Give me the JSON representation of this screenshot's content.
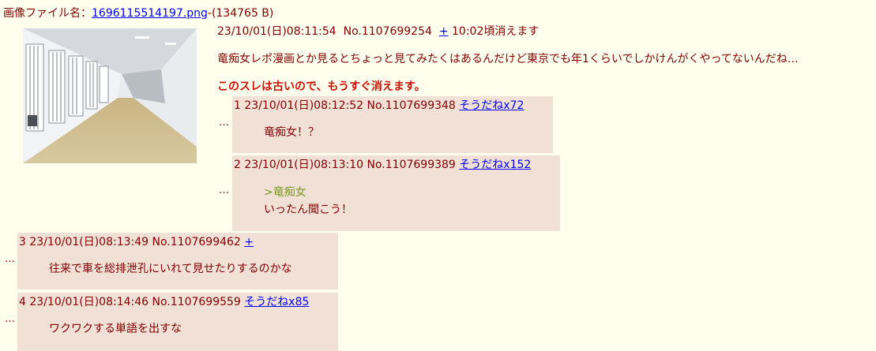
{
  "file": {
    "label": "画像ファイル名：",
    "name": "1696115514197.png",
    "size": "-(134765 B)"
  },
  "thumbnail": {
    "icon": "corridor-photo"
  },
  "op": {
    "date": "23/10/01(日)08:11:54",
    "no": "No.1107699254",
    "plus": "+",
    "expiry": "10:02頃消えます",
    "body": "竜痴女レポ漫画とか見るとちょっと見てみたくはあるんだけど東京でも年1くらいでしかけんがくやってないんだね…",
    "warning": "このスレは古いので、もうすぐ消えます。"
  },
  "replies": [
    {
      "num": "1",
      "date": "23/10/01(日)08:12:52",
      "no": "No.1107699348",
      "sodane": "そうだねx72",
      "lines": [
        "竜痴女！？"
      ]
    },
    {
      "num": "2",
      "date": "23/10/01(日)08:13:10",
      "no": "No.1107699389",
      "sodane": "そうだねx152",
      "quote": ">竜痴女",
      "lines": [
        "いったん聞こう！"
      ]
    },
    {
      "num": "3",
      "date": "23/10/01(日)08:13:49",
      "no": "No.1107699462",
      "sodane": "+",
      "lines": [
        "往来で車を総排泄孔にいれて見せたりするのかな"
      ]
    },
    {
      "num": "4",
      "date": "23/10/01(日)08:14:46",
      "no": "No.1107699559",
      "sodane": "そうだねx85",
      "lines": [
        "ワクワクする単語を出すな"
      ]
    }
  ],
  "dots": "…",
  "colors": {
    "background": "#ffffee",
    "reply_bg": "#f0e0d6",
    "text": "#800000",
    "warning": "#cc1105",
    "quote": "#789922",
    "link": "#0000ee"
  }
}
